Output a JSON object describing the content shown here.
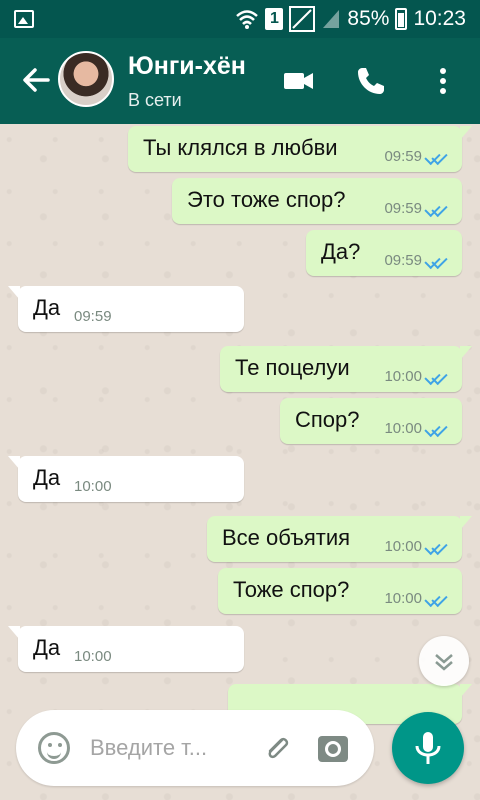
{
  "status_bar": {
    "battery": "85%",
    "time": "10:23",
    "sim": "1"
  },
  "header": {
    "contact_name": "Юнги-хён",
    "status": "В сети"
  },
  "messages": [
    {
      "dir": "out",
      "text": "Ты клялся в любви",
      "time": "09:59",
      "read": true
    },
    {
      "dir": "out",
      "text": "Это тоже спор?",
      "time": "09:59",
      "read": true
    },
    {
      "dir": "out",
      "text": "Да?",
      "time": "09:59",
      "read": true
    },
    {
      "dir": "in",
      "text": "Да",
      "time": "09:59"
    },
    {
      "dir": "out",
      "text": "Те поцелуи",
      "time": "10:00",
      "read": true
    },
    {
      "dir": "out",
      "text": "Спор?",
      "time": "10:00",
      "read": true
    },
    {
      "dir": "in",
      "text": "Да",
      "time": "10:00"
    },
    {
      "dir": "out",
      "text": "Все объятия",
      "time": "10:00",
      "read": true
    },
    {
      "dir": "out",
      "text": "Тоже спор?",
      "time": "10:00",
      "read": true
    },
    {
      "dir": "in",
      "text": "Да",
      "time": "10:00"
    }
  ],
  "composer": {
    "placeholder": "Введите т..."
  },
  "colors": {
    "header": "#075e54",
    "status_bar": "#04564f",
    "outgoing": "#dcf8c6",
    "incoming": "#ffffff",
    "accent": "#009688",
    "read_ticks": "#3fa3e6"
  }
}
